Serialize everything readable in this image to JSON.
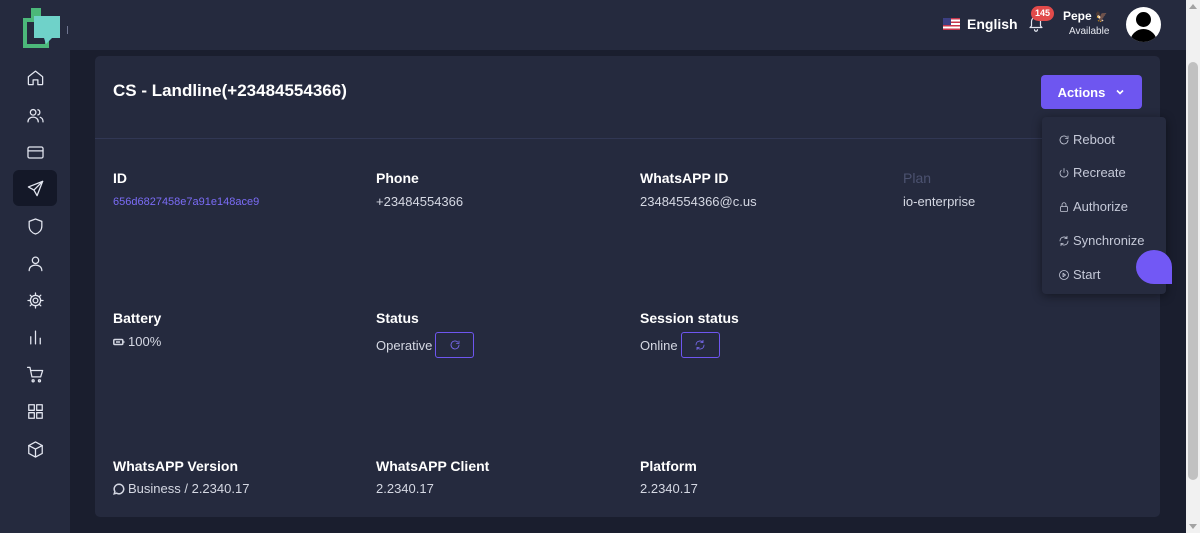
{
  "topbar": {
    "language": {
      "label": "English",
      "flag_icon": "us-flag-icon"
    },
    "notifications": {
      "count": "145",
      "icon": "bell-icon"
    },
    "user": {
      "name": "Pepe",
      "emoji": "🦅",
      "status": "Available"
    }
  },
  "sidebar": {
    "items": [
      {
        "name": "home",
        "icon": "home-icon",
        "active": false
      },
      {
        "name": "contacts",
        "icon": "users-icon",
        "active": false
      },
      {
        "name": "billing",
        "icon": "credit-card-icon",
        "active": false
      },
      {
        "name": "send",
        "icon": "send-icon",
        "active": true
      },
      {
        "name": "security",
        "icon": "shield-icon",
        "active": false
      },
      {
        "name": "profile",
        "icon": "user-icon",
        "active": false
      },
      {
        "name": "settings",
        "icon": "gear-icon",
        "active": false
      },
      {
        "name": "stats",
        "icon": "bar-chart-icon",
        "active": false
      },
      {
        "name": "shop",
        "icon": "cart-icon",
        "active": false
      },
      {
        "name": "apps",
        "icon": "grid-icon",
        "active": false
      },
      {
        "name": "packages",
        "icon": "box-icon",
        "active": false
      }
    ]
  },
  "device": {
    "title": "CS - Landline(+23484554366)",
    "actions_label": "Actions",
    "menu": {
      "reboot": "Reboot",
      "recreate": "Recreate",
      "authorize": "Authorize",
      "synchronize": "Synchronize",
      "start": "Start"
    },
    "fields": {
      "id": {
        "label": "ID",
        "value": "656d6827458e7a91e148ace9"
      },
      "phone": {
        "label": "Phone",
        "value": "+23484554366"
      },
      "whatsapp_id": {
        "label": "WhatsAPP ID",
        "value": "23484554366@c.us"
      },
      "plan": {
        "label": "Plan",
        "value": "io-enterprise"
      },
      "battery": {
        "label": "Battery",
        "value": "100%"
      },
      "status": {
        "label": "Status",
        "value": "Operative"
      },
      "session_status": {
        "label": "Session status",
        "value": "Online"
      },
      "whatsapp_version": {
        "label": "WhatsAPP Version",
        "value": "Business / 2.2340.17"
      },
      "whatsapp_client": {
        "label": "WhatsAPP Client",
        "value": "2.2340.17"
      },
      "platform": {
        "label": "Platform",
        "value": "2.2340.17"
      }
    }
  },
  "colors": {
    "accent": "#6e56f0",
    "sidebar_bg": "#252a3e",
    "page_bg": "#1a1e2e",
    "card_bg": "#252a3e",
    "notification_badge": "#e14a4a"
  }
}
